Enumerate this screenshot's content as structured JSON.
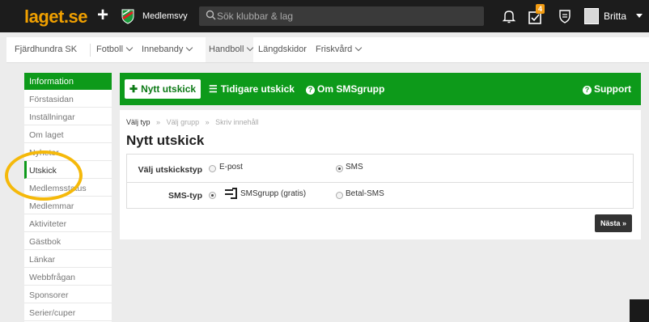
{
  "topbar": {
    "logo_text": "laget.se",
    "add_label": "+",
    "club_label": "Medlemsvy",
    "search_placeholder": "Sök klubbar & lag",
    "notification_count": "4",
    "user_name": "Britta"
  },
  "subnav": {
    "club": "Fjärdhundra SK",
    "items": [
      {
        "label": "Fotboll",
        "has_dropdown": true
      },
      {
        "label": "Innebandy",
        "has_dropdown": true
      },
      {
        "label": "Handboll",
        "has_dropdown": true,
        "active": true
      },
      {
        "label": "Längdskidor",
        "has_dropdown": false
      },
      {
        "label": "Friskvård",
        "has_dropdown": true
      }
    ]
  },
  "sidebar": {
    "header": "Information",
    "items": [
      {
        "label": "Förstasidan"
      },
      {
        "label": "Inställningar"
      },
      {
        "label": "Om laget"
      },
      {
        "label": "Nyheter"
      },
      {
        "label": "Utskick",
        "current": true
      },
      {
        "label": "Medlemsstatus"
      },
      {
        "label": "Medlemmar"
      },
      {
        "label": "Aktiviteter"
      },
      {
        "label": "Gästbok"
      },
      {
        "label": "Länkar"
      },
      {
        "label": "Webbfrågan"
      },
      {
        "label": "Sponsorer"
      },
      {
        "label": "Serier/cuper"
      }
    ]
  },
  "actionbar": {
    "new_label": "Nytt utskick",
    "previous_label": "Tidigare utskick",
    "about_label": "Om SMSgrupp",
    "support_label": "Support"
  },
  "main": {
    "breadcrumb": [
      "Välj typ",
      "Välj grupp",
      "Skriv innehåll"
    ],
    "breadcrumb_sep": "»",
    "title": "Nytt utskick",
    "row1_label": "Välj utskickstyp",
    "row1_options": [
      "E-post",
      "SMS"
    ],
    "row1_selected": "SMS",
    "row2_label": "SMS-typ",
    "row2_options": [
      "SMSgrupp (gratis)",
      "Betal-SMS"
    ],
    "row2_selected": "SMSgrupp (gratis)",
    "next_label": "Nästa »"
  },
  "colors": {
    "brand_green": "#0d9a1a",
    "topbar": "#1c1c1c",
    "logo_orange": "#f0a000",
    "highlight_yellow": "#f5b90a",
    "badge": "#f39c12"
  }
}
